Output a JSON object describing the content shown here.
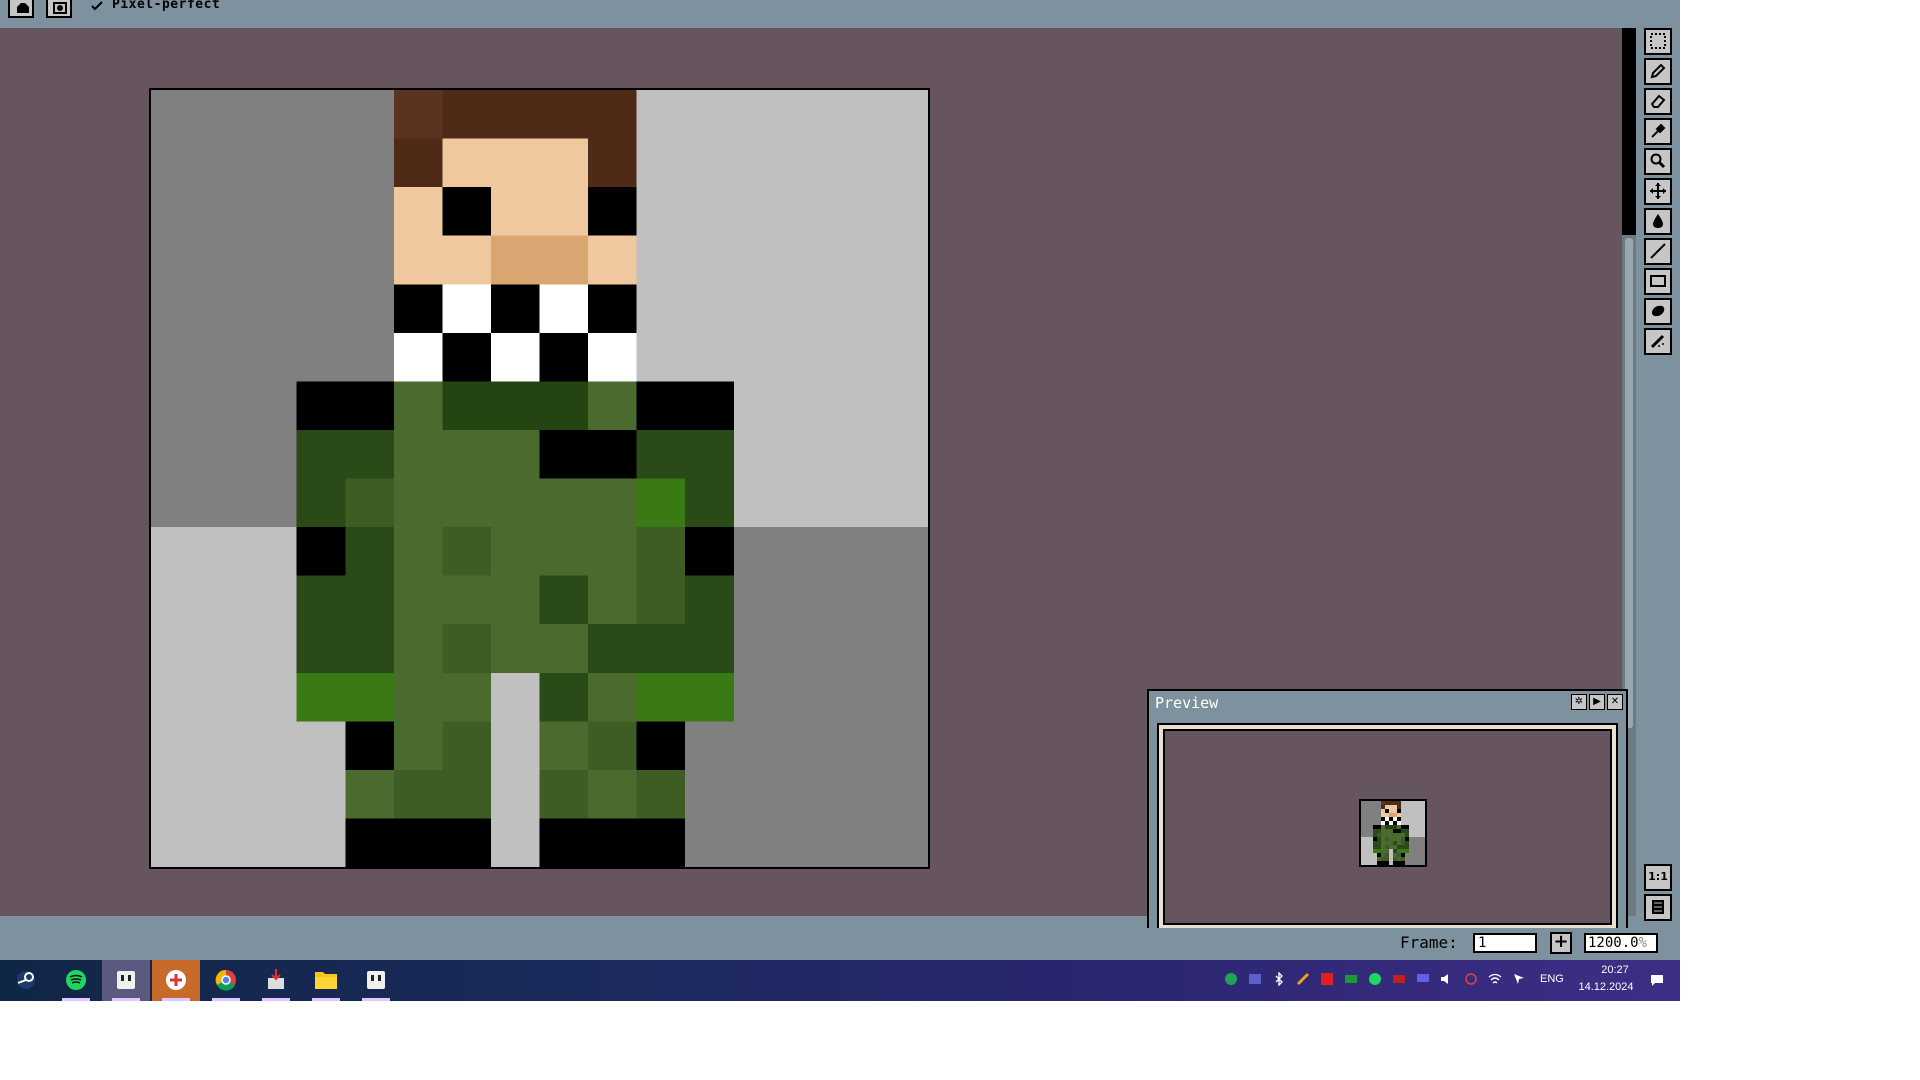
{
  "toolbar_top": {
    "pixel_perfect_label": "Pixel-perfect",
    "pixel_perfect_checked": true
  },
  "canvas": {
    "background_colors": {
      "dark": "#808080",
      "light": "#c0c0c0"
    },
    "sprite_description_grid_size": 16
  },
  "tools": [
    {
      "name": "marquee-icon"
    },
    {
      "name": "pencil-icon"
    },
    {
      "name": "eraser-icon"
    },
    {
      "name": "eyedropper-icon"
    },
    {
      "name": "zoom-icon"
    },
    {
      "name": "move-icon"
    },
    {
      "name": "fill-icon"
    },
    {
      "name": "line-icon"
    },
    {
      "name": "rectangle-icon"
    },
    {
      "name": "ellipse-icon"
    },
    {
      "name": "spray-icon"
    }
  ],
  "side_buttons": [
    {
      "label": "1:1",
      "name": "actual-size-button"
    },
    {
      "label": "",
      "name": "timeline-button"
    }
  ],
  "preview": {
    "title": "Preview"
  },
  "status": {
    "frame_label": "Frame:",
    "frame_value": "1",
    "add_frame": "+",
    "zoom_value": "1200.0",
    "zoom_suffix": "%"
  },
  "taskbar": {
    "apps": [
      "steam-icon",
      "spotify-icon",
      "aseprite-icon",
      "medical-app-icon",
      "chrome-icon",
      "installer-icon",
      "file-explorer-icon",
      "aseprite-icon-2"
    ],
    "tray": {
      "lang": "ENG",
      "time": "20:27",
      "date": "14.12.2024"
    }
  },
  "colors": {
    "workspace": "#66555f",
    "chrome": "#7d929e",
    "button_face": "#c6c6c6"
  }
}
